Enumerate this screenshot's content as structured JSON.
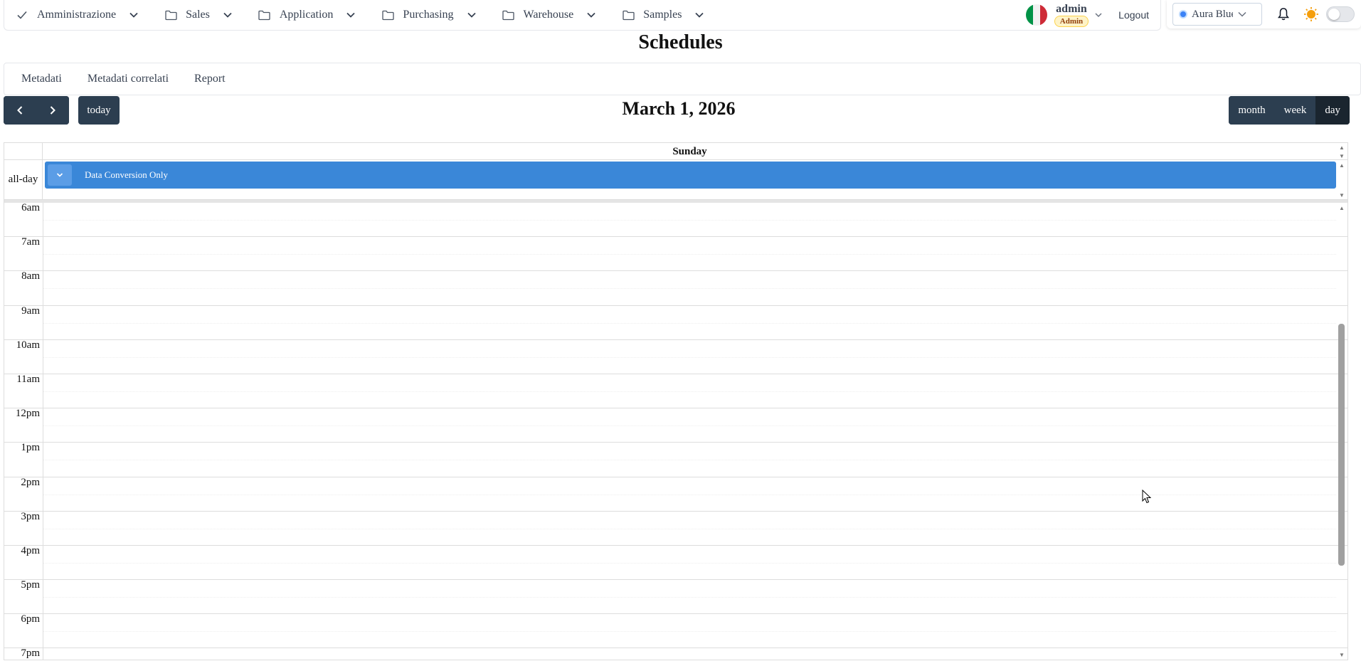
{
  "nav": {
    "items": [
      {
        "label": "Amministrazione",
        "icon": "check-icon"
      },
      {
        "label": "Sales",
        "icon": "folder-icon"
      },
      {
        "label": "Application",
        "icon": "folder-icon"
      },
      {
        "label": "Purchasing",
        "icon": "folder-icon"
      },
      {
        "label": "Warehouse",
        "icon": "folder-icon"
      },
      {
        "label": "Samples",
        "icon": "folder-icon"
      }
    ],
    "user_name": "admin",
    "user_role": "Admin",
    "logout_label": "Logout",
    "language_flag": "italian-flag-icon"
  },
  "theme": {
    "selected": "Aura Blue",
    "accent": "#3b82f6"
  },
  "page": {
    "title": "Schedules"
  },
  "tabs": [
    "Metadati",
    "Metadati correlati",
    "Report"
  ],
  "calendar": {
    "today_label": "today",
    "title": "March 1, 2026",
    "views": [
      "month",
      "week",
      "day"
    ],
    "active_view": "day",
    "day_header": "Sunday",
    "allday_label": "all-day",
    "event": {
      "title": "Data Conversion Only",
      "color": "#3a87d8"
    },
    "time_slots": [
      "6am",
      "7am",
      "8am",
      "9am",
      "10am",
      "11am",
      "12pm",
      "1pm",
      "2pm",
      "3pm",
      "4pm",
      "5pm",
      "6pm",
      "7pm"
    ]
  },
  "colors": {
    "toolbar_button": "#2c3e50",
    "event_blue": "#3a87d8"
  }
}
